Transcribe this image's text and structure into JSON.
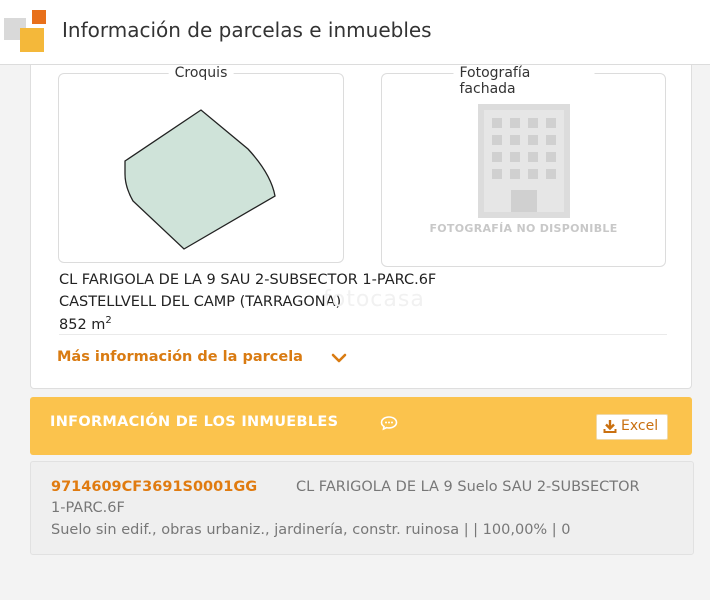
{
  "header": {
    "title": "Información de parcelas e inmuebles"
  },
  "parcel": {
    "sketch_label": "Croquis",
    "photo_label": "Fotografía fachada",
    "no_photo": "FOTOGRAFÍA NO DISPONIBLE",
    "address_line1": "CL FARIGOLA DE LA 9 SAU 2-SUBSECTOR 1-PARC.6F",
    "address_line2": "CASTELLVELL DEL CAMP (TARRAGONA)",
    "area_value": "852 m",
    "area_unit_sup": "2",
    "watermark": "fotocasa",
    "more_info_link": "Más información de la parcela",
    "polygon_fill": "#cfe3d9",
    "polygon_stroke": "#222222"
  },
  "properties": {
    "section_title": "INFORMACIÓN DE LOS INMUEBLES",
    "excel_label": "Excel",
    "accent_color": "#fbc34d",
    "items": [
      {
        "reference": "9714609CF3691S0001GG",
        "address_line1": "CL FARIGOLA DE LA 9 Suelo SAU 2-SUBSECTOR",
        "address_line2": "1-PARC.6F",
        "description": "Suelo sin edif., obras urbaniz., jardinería, constr. ruinosa | | 100,00% | 0"
      }
    ]
  }
}
